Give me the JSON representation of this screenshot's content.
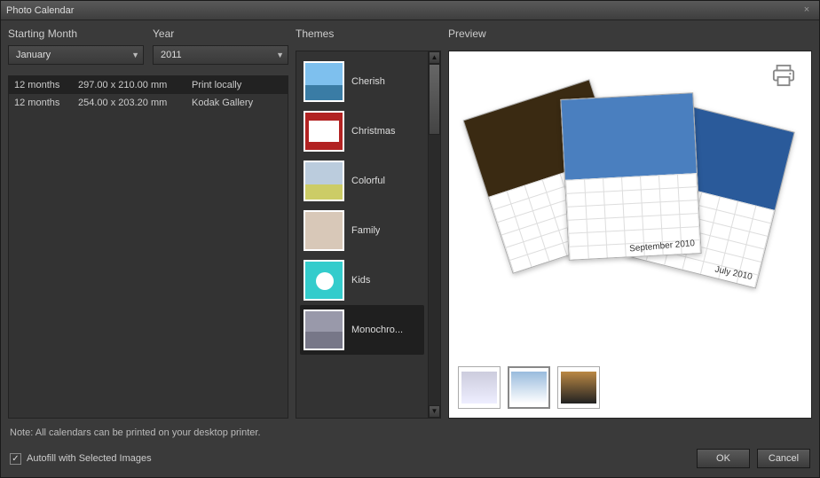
{
  "title": "Photo Calendar",
  "labels": {
    "starting_month": "Starting Month",
    "year": "Year",
    "themes": "Themes",
    "preview": "Preview"
  },
  "starting_month": {
    "value": "January"
  },
  "year": {
    "value": "2011"
  },
  "print_options": [
    {
      "duration": "12 months",
      "dimensions": "297.00 x 210.00 mm",
      "target": "Print locally",
      "selected": true
    },
    {
      "duration": "12 months",
      "dimensions": "254.00 x 203.20 mm",
      "target": "Kodak Gallery",
      "selected": false
    }
  ],
  "themes": [
    {
      "name": "Cherish",
      "swatch": "sky",
      "selected": false
    },
    {
      "name": "Christmas",
      "swatch": "red",
      "selected": false
    },
    {
      "name": "Colorful",
      "swatch": "bridge",
      "selected": false
    },
    {
      "name": "Family",
      "swatch": "people",
      "selected": false
    },
    {
      "name": "Kids",
      "swatch": "kids",
      "selected": false
    },
    {
      "name": "Monochro...",
      "swatch": "mono",
      "selected": true
    }
  ],
  "preview_months": [
    "September 2010",
    "July 2010"
  ],
  "preview_thumbs": [
    {
      "selected": false
    },
    {
      "selected": true
    },
    {
      "selected": false
    }
  ],
  "note": "Note: All calendars can be printed on your desktop printer.",
  "autofill": {
    "checked": true,
    "label": "Autofill with Selected Images"
  },
  "buttons": {
    "ok": "OK",
    "cancel": "Cancel"
  },
  "icons": {
    "close": "×",
    "dropdown": "▼",
    "check": "✓"
  }
}
